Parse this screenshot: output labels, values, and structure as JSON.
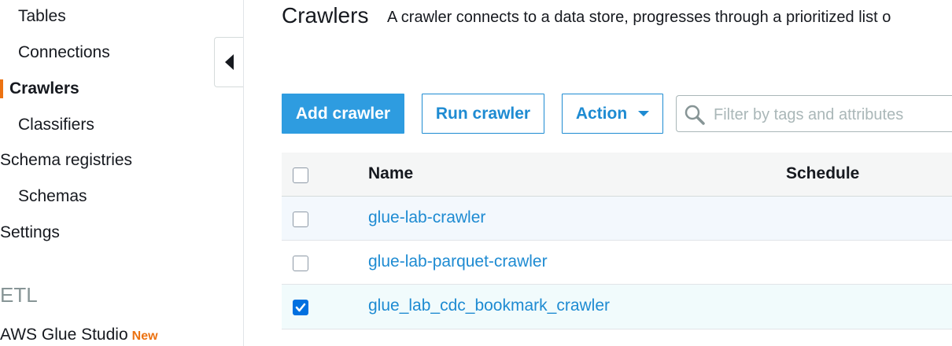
{
  "sidebar": {
    "items": [
      {
        "label": "Tables"
      },
      {
        "label": "Connections"
      },
      {
        "label": "Crawlers"
      },
      {
        "label": "Classifiers"
      },
      {
        "label": "Schema registries"
      },
      {
        "label": "Schemas"
      },
      {
        "label": "Settings"
      }
    ],
    "section_title": "ETL",
    "studio": {
      "label": "AWS Glue Studio",
      "badge": "New"
    },
    "accent_color": "#ec7211"
  },
  "header": {
    "title": "Crawlers",
    "description": "A crawler connects to a data store, progresses through a prioritized list o"
  },
  "toolbar": {
    "add_label": "Add crawler",
    "run_label": "Run crawler",
    "action_label": "Action",
    "search_placeholder": "Filter by tags and attributes"
  },
  "table": {
    "columns": [
      "Name",
      "Schedule"
    ],
    "rows": [
      {
        "name": "glue-lab-crawler",
        "schedule": "",
        "checked": false
      },
      {
        "name": "glue-lab-parquet-crawler",
        "schedule": "",
        "checked": false
      },
      {
        "name": "glue_lab_cdc_bookmark_crawler",
        "schedule": "",
        "checked": true
      }
    ]
  }
}
